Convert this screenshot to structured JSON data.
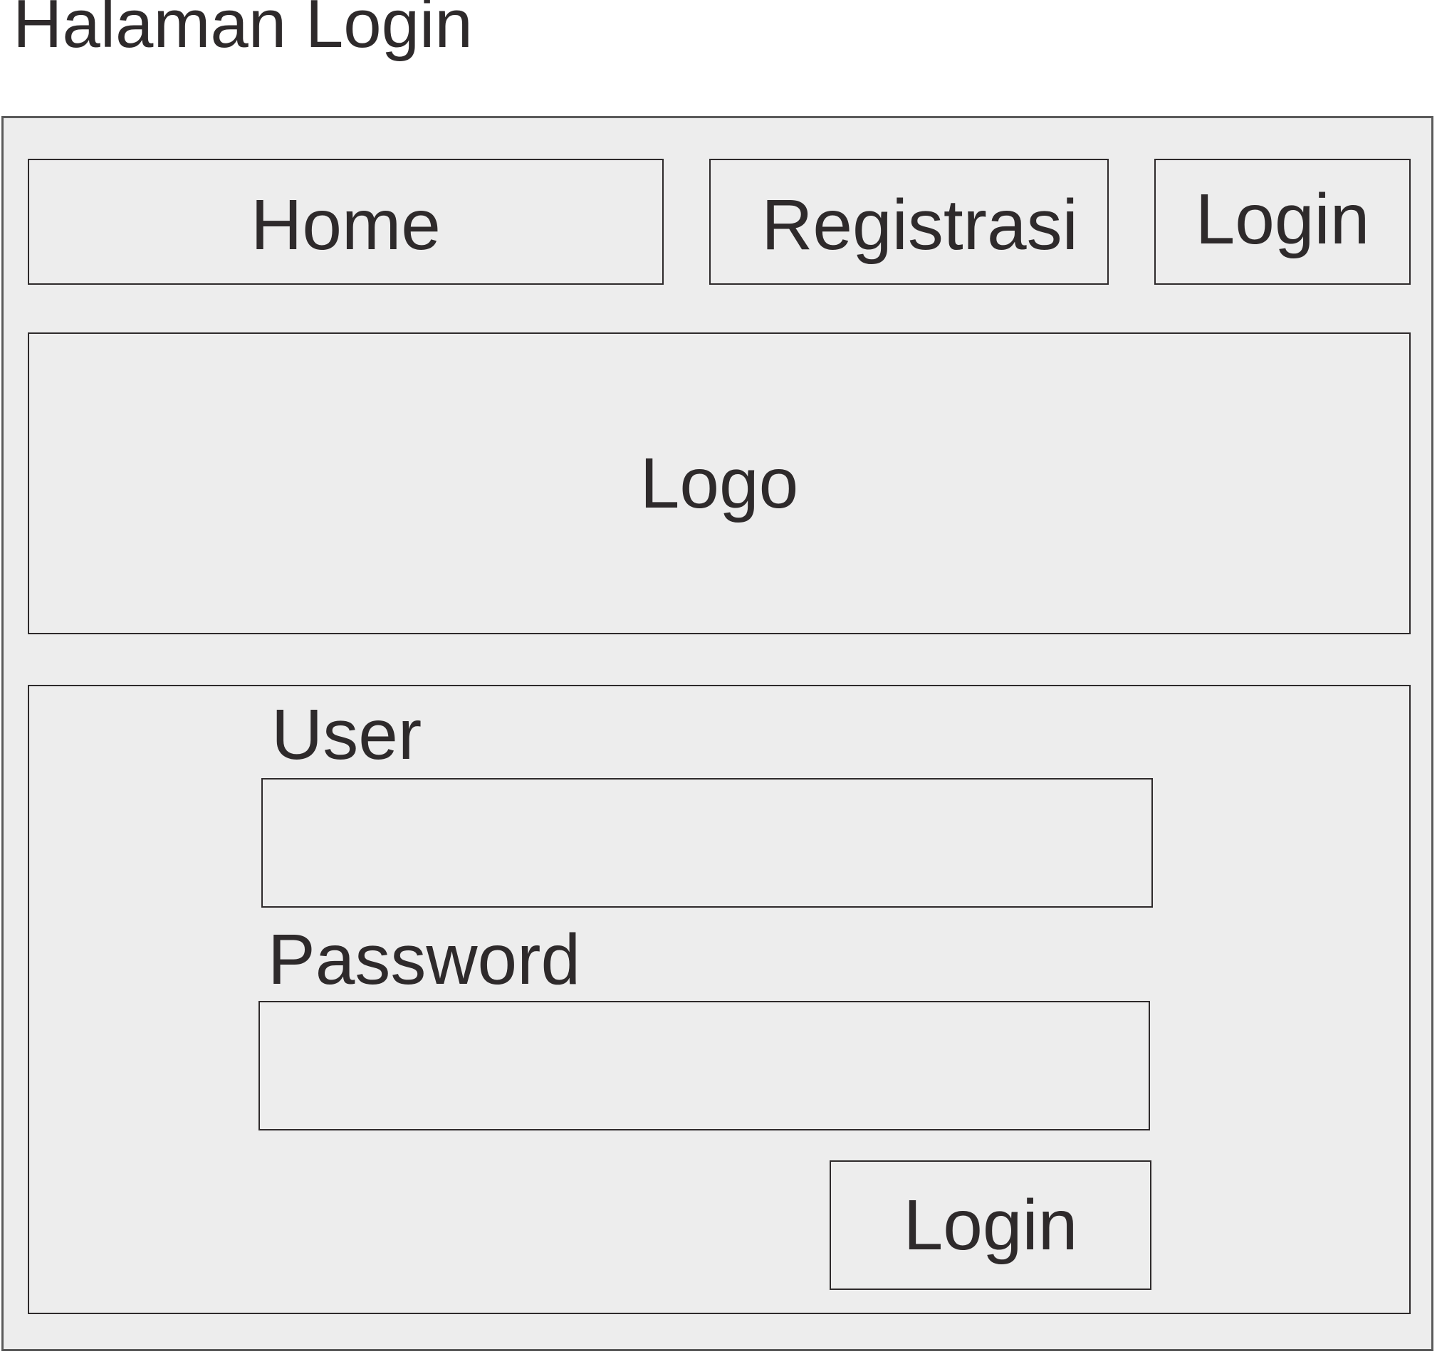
{
  "page": {
    "title": "Halaman Login"
  },
  "nav": {
    "home_label": "Home",
    "register_label": "Registrasi",
    "login_label": "Login"
  },
  "logo": {
    "label": "Logo"
  },
  "form": {
    "user_label": "User",
    "password_label": "Password",
    "submit_label": "Login",
    "user_value": "",
    "password_value": ""
  },
  "colors": {
    "frame_background": "#ededed",
    "frame_border": "#5a5a5a",
    "text": "#2e2a2b",
    "page_background": "#ffffff"
  }
}
